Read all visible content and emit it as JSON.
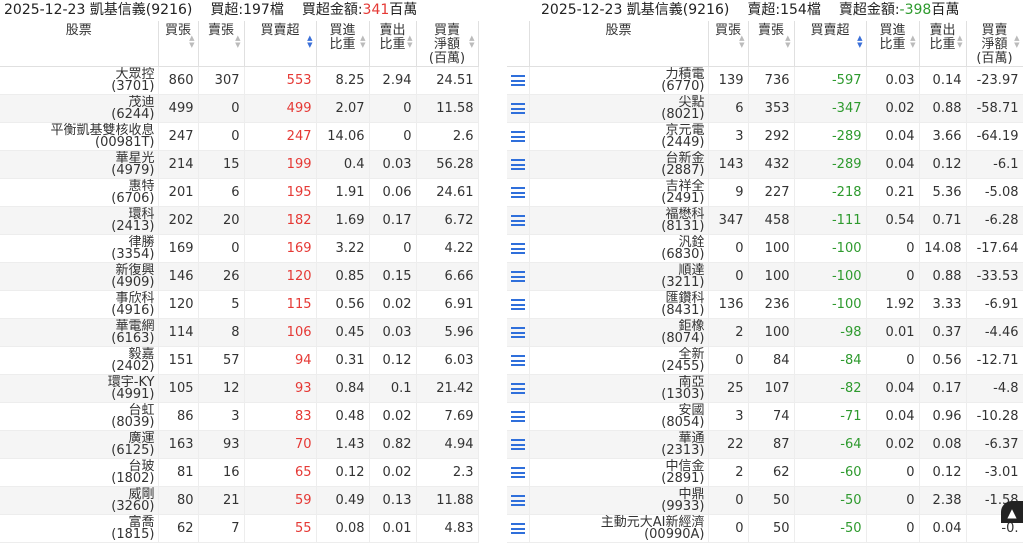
{
  "left": {
    "title": {
      "date_broker": "2025-12-23 凱基信義(9216)",
      "count_label": "買超:197檔",
      "amount_prefix": "買超金額:",
      "amount_value": "341",
      "amount_unit": "百萬"
    },
    "headers": [
      "股票",
      "買張",
      "賣張",
      "買賣超",
      "買進\n比重",
      "賣出\n比重",
      "買賣\n淨額\n(百萬)"
    ],
    "rows": [
      {
        "name": "大眾控",
        "code": "(3701)",
        "buy": "860",
        "sell": "307",
        "net": "553",
        "buy_pct": "8.25",
        "sell_pct": "2.94",
        "amount": "24.51"
      },
      {
        "name": "茂迪",
        "code": "(6244)",
        "buy": "499",
        "sell": "0",
        "net": "499",
        "buy_pct": "2.07",
        "sell_pct": "0",
        "amount": "11.58"
      },
      {
        "name": "平衡凱基雙核收息",
        "code": "(00981T)",
        "buy": "247",
        "sell": "0",
        "net": "247",
        "buy_pct": "14.06",
        "sell_pct": "0",
        "amount": "2.6"
      },
      {
        "name": "華星光",
        "code": "(4979)",
        "buy": "214",
        "sell": "15",
        "net": "199",
        "buy_pct": "0.4",
        "sell_pct": "0.03",
        "amount": "56.28"
      },
      {
        "name": "惠特",
        "code": "(6706)",
        "buy": "201",
        "sell": "6",
        "net": "195",
        "buy_pct": "1.91",
        "sell_pct": "0.06",
        "amount": "24.61"
      },
      {
        "name": "環科",
        "code": "(2413)",
        "buy": "202",
        "sell": "20",
        "net": "182",
        "buy_pct": "1.69",
        "sell_pct": "0.17",
        "amount": "6.72"
      },
      {
        "name": "律勝",
        "code": "(3354)",
        "buy": "169",
        "sell": "0",
        "net": "169",
        "buy_pct": "3.22",
        "sell_pct": "0",
        "amount": "4.22"
      },
      {
        "name": "新復興",
        "code": "(4909)",
        "buy": "146",
        "sell": "26",
        "net": "120",
        "buy_pct": "0.85",
        "sell_pct": "0.15",
        "amount": "6.66"
      },
      {
        "name": "事欣科",
        "code": "(4916)",
        "buy": "120",
        "sell": "5",
        "net": "115",
        "buy_pct": "0.56",
        "sell_pct": "0.02",
        "amount": "6.91"
      },
      {
        "name": "華電網",
        "code": "(6163)",
        "buy": "114",
        "sell": "8",
        "net": "106",
        "buy_pct": "0.45",
        "sell_pct": "0.03",
        "amount": "5.96"
      },
      {
        "name": "毅嘉",
        "code": "(2402)",
        "buy": "151",
        "sell": "57",
        "net": "94",
        "buy_pct": "0.31",
        "sell_pct": "0.12",
        "amount": "6.03"
      },
      {
        "name": "環宇-KY",
        "code": "(4991)",
        "buy": "105",
        "sell": "12",
        "net": "93",
        "buy_pct": "0.84",
        "sell_pct": "0.1",
        "amount": "21.42"
      },
      {
        "name": "台虹",
        "code": "(8039)",
        "buy": "86",
        "sell": "3",
        "net": "83",
        "buy_pct": "0.48",
        "sell_pct": "0.02",
        "amount": "7.69"
      },
      {
        "name": "廣運",
        "code": "(6125)",
        "buy": "163",
        "sell": "93",
        "net": "70",
        "buy_pct": "1.43",
        "sell_pct": "0.82",
        "amount": "4.94"
      },
      {
        "name": "台玻",
        "code": "(1802)",
        "buy": "81",
        "sell": "16",
        "net": "65",
        "buy_pct": "0.12",
        "sell_pct": "0.02",
        "amount": "2.3"
      },
      {
        "name": "威剛",
        "code": "(3260)",
        "buy": "80",
        "sell": "21",
        "net": "59",
        "buy_pct": "0.49",
        "sell_pct": "0.13",
        "amount": "11.88"
      },
      {
        "name": "富喬",
        "code": "(1815)",
        "buy": "62",
        "sell": "7",
        "net": "55",
        "buy_pct": "0.08",
        "sell_pct": "0.01",
        "amount": "4.83"
      }
    ]
  },
  "right": {
    "title": {
      "date_broker": "2025-12-23 凱基信義(9216)",
      "count_label": "賣超:154檔",
      "amount_prefix": "賣超金額:",
      "amount_value": "-398",
      "amount_unit": "百萬"
    },
    "headers": [
      "股票",
      "買張",
      "賣張",
      "買賣超",
      "買進\n比重",
      "賣出\n比重",
      "買賣\n淨額\n(百萬)"
    ],
    "rows": [
      {
        "name": "力積電",
        "code": "(6770)",
        "buy": "139",
        "sell": "736",
        "net": "-597",
        "buy_pct": "0.03",
        "sell_pct": "0.14",
        "amount": "-23.97"
      },
      {
        "name": "尖點",
        "code": "(8021)",
        "buy": "6",
        "sell": "353",
        "net": "-347",
        "buy_pct": "0.02",
        "sell_pct": "0.88",
        "amount": "-58.71"
      },
      {
        "name": "京元電",
        "code": "(2449)",
        "buy": "3",
        "sell": "292",
        "net": "-289",
        "buy_pct": "0.04",
        "sell_pct": "3.66",
        "amount": "-64.19"
      },
      {
        "name": "台新金",
        "code": "(2887)",
        "buy": "143",
        "sell": "432",
        "net": "-289",
        "buy_pct": "0.04",
        "sell_pct": "0.12",
        "amount": "-6.1"
      },
      {
        "name": "吉祥全",
        "code": "(2491)",
        "buy": "9",
        "sell": "227",
        "net": "-218",
        "buy_pct": "0.21",
        "sell_pct": "5.36",
        "amount": "-5.08"
      },
      {
        "name": "福懋科",
        "code": "(8131)",
        "buy": "347",
        "sell": "458",
        "net": "-111",
        "buy_pct": "0.54",
        "sell_pct": "0.71",
        "amount": "-6.28"
      },
      {
        "name": "汎銓",
        "code": "(6830)",
        "buy": "0",
        "sell": "100",
        "net": "-100",
        "buy_pct": "0",
        "sell_pct": "14.08",
        "amount": "-17.64"
      },
      {
        "name": "順達",
        "code": "(3211)",
        "buy": "0",
        "sell": "100",
        "net": "-100",
        "buy_pct": "0",
        "sell_pct": "0.88",
        "amount": "-33.53"
      },
      {
        "name": "匯鑽科",
        "code": "(8431)",
        "buy": "136",
        "sell": "236",
        "net": "-100",
        "buy_pct": "1.92",
        "sell_pct": "3.33",
        "amount": "-6.91"
      },
      {
        "name": "鉅橡",
        "code": "(8074)",
        "buy": "2",
        "sell": "100",
        "net": "-98",
        "buy_pct": "0.01",
        "sell_pct": "0.37",
        "amount": "-4.46"
      },
      {
        "name": "全新",
        "code": "(2455)",
        "buy": "0",
        "sell": "84",
        "net": "-84",
        "buy_pct": "0",
        "sell_pct": "0.56",
        "amount": "-12.71"
      },
      {
        "name": "南亞",
        "code": "(1303)",
        "buy": "25",
        "sell": "107",
        "net": "-82",
        "buy_pct": "0.04",
        "sell_pct": "0.17",
        "amount": "-4.8"
      },
      {
        "name": "安國",
        "code": "(8054)",
        "buy": "3",
        "sell": "74",
        "net": "-71",
        "buy_pct": "0.04",
        "sell_pct": "0.96",
        "amount": "-10.28"
      },
      {
        "name": "華通",
        "code": "(2313)",
        "buy": "22",
        "sell": "87",
        "net": "-64",
        "buy_pct": "0.02",
        "sell_pct": "0.08",
        "amount": "-6.37"
      },
      {
        "name": "中信金",
        "code": "(2891)",
        "buy": "2",
        "sell": "62",
        "net": "-60",
        "buy_pct": "0",
        "sell_pct": "0.12",
        "amount": "-3.01"
      },
      {
        "name": "中鼎",
        "code": "(9933)",
        "buy": "0",
        "sell": "50",
        "net": "-50",
        "buy_pct": "0",
        "sell_pct": "2.38",
        "amount": "-1.58"
      },
      {
        "name": "主動元大AI新經濟",
        "code": "(00990A)",
        "buy": "0",
        "sell": "50",
        "net": "-50",
        "buy_pct": "0",
        "sell_pct": "0.04",
        "amount": "-0."
      }
    ]
  },
  "icons": {
    "row_icon": "list-icon",
    "sort_icon": "sort-arrows-icon",
    "scroll_button_icon": "chevron-up-icon"
  },
  "colors": {
    "positive": "#e53935",
    "negative": "#2e9a2e",
    "accent": "#2f6fdb",
    "stripe": "#f5f5f5"
  }
}
